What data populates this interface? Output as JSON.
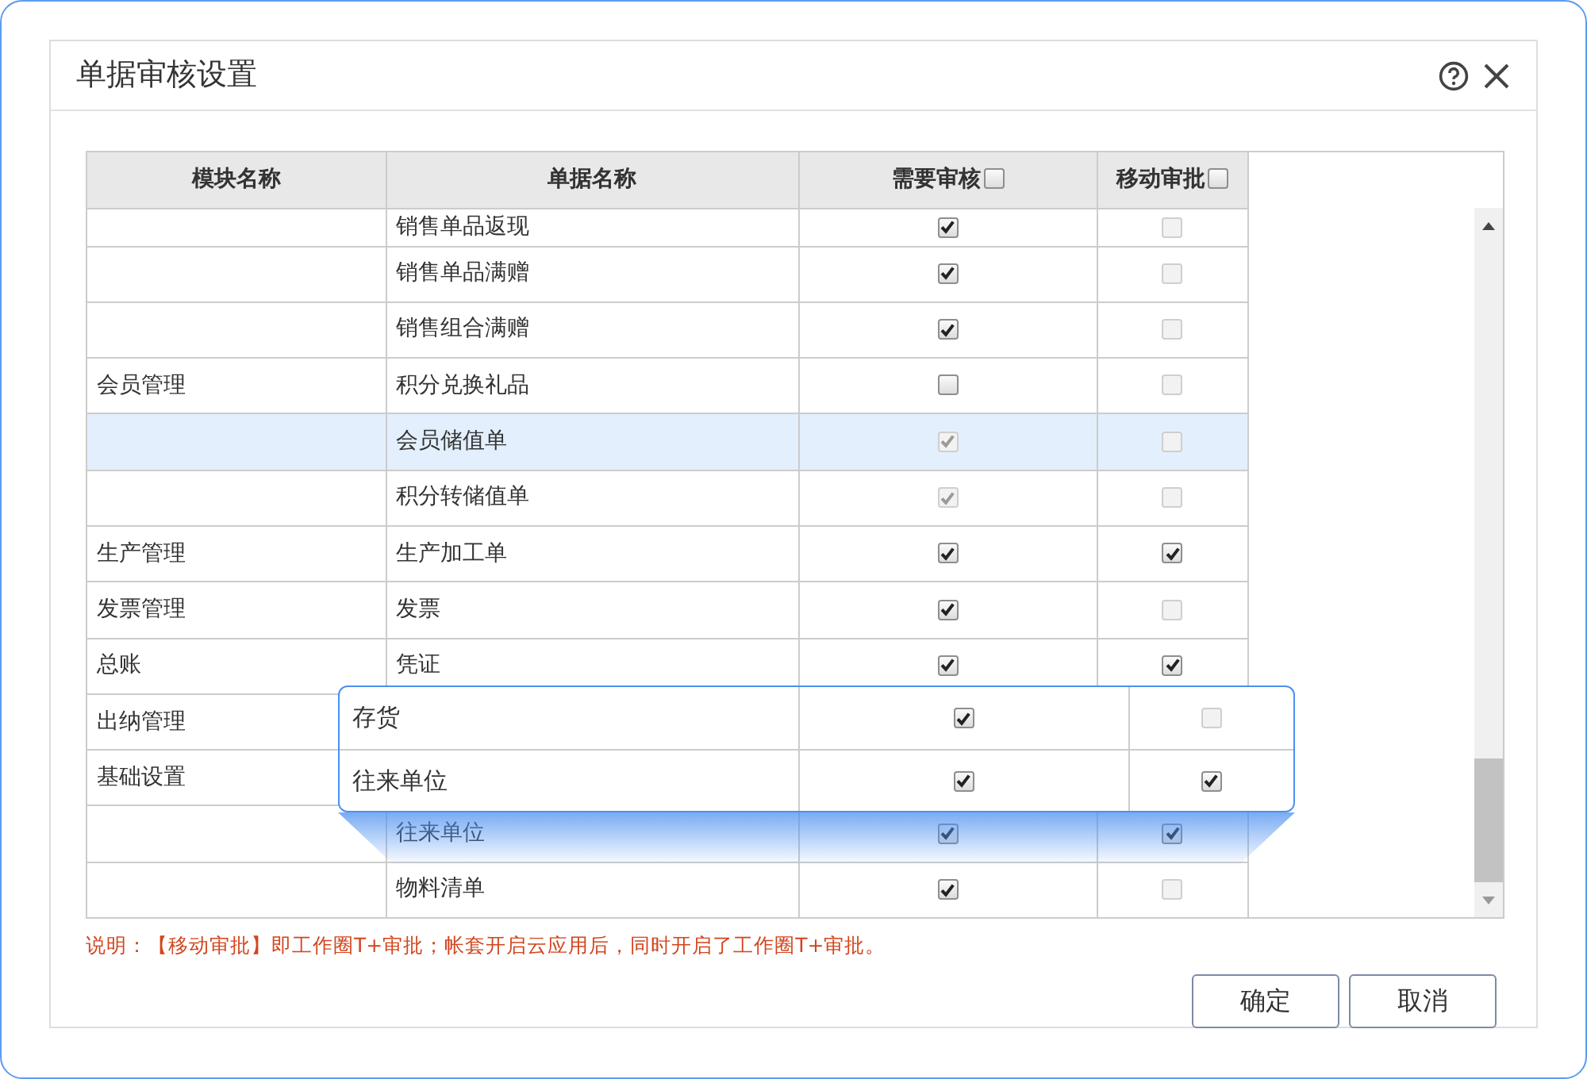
{
  "dialog": {
    "title": "单据审核设置"
  },
  "table": {
    "columns": [
      {
        "label": "模块名称",
        "kind": "text"
      },
      {
        "label": "单据名称",
        "kind": "text"
      },
      {
        "label": "需要审核",
        "kind": "checkbox",
        "checked": false
      },
      {
        "label": "移动审批",
        "kind": "checkbox",
        "checked": false
      }
    ],
    "rows": [
      {
        "module": "",
        "document": "销售单品返现",
        "selected": false,
        "audit": {
          "checked": true,
          "disabled": false
        },
        "mobile": {
          "checked": false,
          "disabled": true
        }
      },
      {
        "module": "",
        "document": "销售单品满赠",
        "selected": false,
        "audit": {
          "checked": true,
          "disabled": false
        },
        "mobile": {
          "checked": false,
          "disabled": true
        }
      },
      {
        "module": "",
        "document": "销售组合满赠",
        "selected": false,
        "audit": {
          "checked": true,
          "disabled": false
        },
        "mobile": {
          "checked": false,
          "disabled": true
        }
      },
      {
        "module": "会员管理",
        "document": "积分兑换礼品",
        "selected": false,
        "audit": {
          "checked": false,
          "disabled": false
        },
        "mobile": {
          "checked": false,
          "disabled": true
        }
      },
      {
        "module": "",
        "document": "会员储值单",
        "selected": true,
        "audit": {
          "checked": true,
          "disabled": true
        },
        "mobile": {
          "checked": false,
          "disabled": true
        }
      },
      {
        "module": "",
        "document": "积分转储值单",
        "selected": false,
        "audit": {
          "checked": true,
          "disabled": true
        },
        "mobile": {
          "checked": false,
          "disabled": true
        }
      },
      {
        "module": "生产管理",
        "document": "生产加工单",
        "selected": false,
        "audit": {
          "checked": true,
          "disabled": false
        },
        "mobile": {
          "checked": true,
          "disabled": false
        }
      },
      {
        "module": "发票管理",
        "document": "发票",
        "selected": false,
        "audit": {
          "checked": true,
          "disabled": false
        },
        "mobile": {
          "checked": false,
          "disabled": true
        }
      },
      {
        "module": "总账",
        "document": "凭证",
        "selected": false,
        "audit": {
          "checked": true,
          "disabled": false
        },
        "mobile": {
          "checked": true,
          "disabled": false
        }
      },
      {
        "module": "出纳管理",
        "selected": false
      },
      {
        "module": "基础设置",
        "selected": false
      },
      {
        "module": "",
        "document": "往来单位",
        "selected": false,
        "audit": {
          "checked": true,
          "disabled": false
        },
        "mobile": {
          "checked": true,
          "disabled": false
        }
      },
      {
        "module": "",
        "document": "物料清单",
        "selected": false,
        "audit": {
          "checked": true,
          "disabled": false
        },
        "mobile": {
          "checked": false,
          "disabled": true
        }
      }
    ]
  },
  "callout": {
    "rows": [
      {
        "document": "存货",
        "audit": {
          "checked": true,
          "disabled": false
        },
        "mobile": {
          "checked": false,
          "disabled": true
        }
      },
      {
        "document": "往来单位",
        "audit": {
          "checked": true,
          "disabled": false
        },
        "mobile": {
          "checked": true,
          "disabled": false
        }
      }
    ]
  },
  "note": "说明：【移动审批】即工作圈T+审批；帐套开启云应用后，同时开启了工作圈T+审批。",
  "buttons": [
    "确定",
    "取消"
  ]
}
